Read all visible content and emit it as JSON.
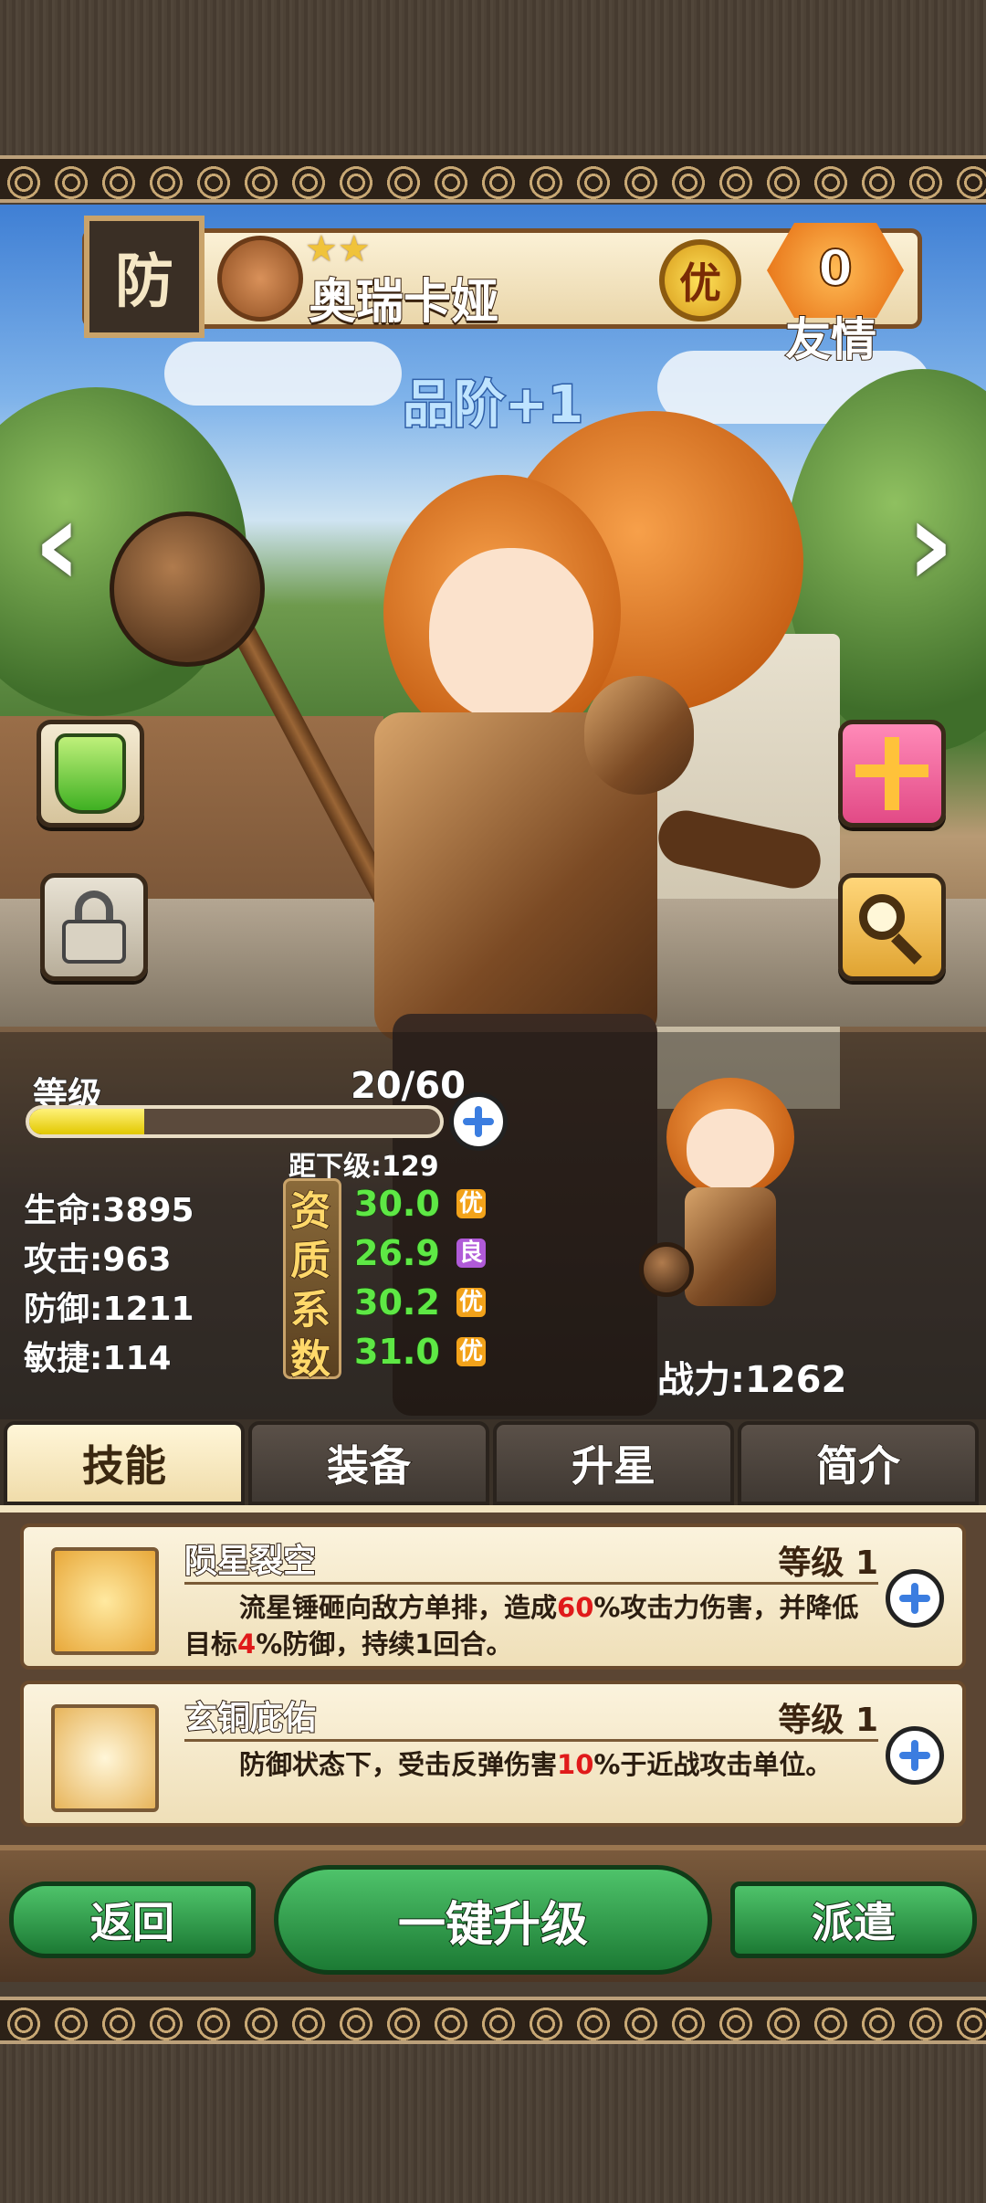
{
  "hero": {
    "class_badge": "防",
    "stars": "★★",
    "name": "奥瑞卡娅",
    "rarity": "优",
    "friendship_value": "0",
    "friendship_label": "友情",
    "quality": "品阶+1"
  },
  "nav": {
    "prev": "‹",
    "next": "›"
  },
  "level": {
    "label": "等级",
    "value": "20/60",
    "progress_fraction": 0.28,
    "to_next": "距下级:129"
  },
  "stats": [
    {
      "text": "生命:3895"
    },
    {
      "text": "攻击:963"
    },
    {
      "text": "防御:1211"
    },
    {
      "text": "敏捷:114"
    }
  ],
  "aptitude": [
    {
      "char": "资",
      "value": "30.0",
      "rank": "优",
      "rank_color": "#f2a21a"
    },
    {
      "char": "质",
      "value": "26.9",
      "rank": "良",
      "rank_color": "#b05ad8"
    },
    {
      "char": "系",
      "value": "30.2",
      "rank": "优",
      "rank_color": "#f2a21a"
    },
    {
      "char": "数",
      "value": "31.0",
      "rank": "优",
      "rank_color": "#f2a21a"
    }
  ],
  "power": "战力:1262",
  "tabs": [
    {
      "label": "技能",
      "active": true
    },
    {
      "label": "装备"
    },
    {
      "label": "升星"
    },
    {
      "label": "简介"
    }
  ],
  "skills": [
    {
      "name": "陨星裂空",
      "level": "等级 1",
      "desc_parts": [
        "流星锤砸向敌方单排，造成",
        "60",
        "%攻击力伤害，并降低目标",
        "4",
        "%防御，持续1回合。"
      ]
    },
    {
      "name": "玄铜庇佑",
      "level": "等级 1",
      "desc_parts": [
        "防御状态下，受击反弹伤害",
        "10",
        "%于近战攻击单位。"
      ]
    }
  ],
  "actions": {
    "back": "返回",
    "upgrade_all": "一键升级",
    "dispatch": "派遣"
  },
  "side_icons": [
    "potion-icon",
    "lock-icon",
    "gift-icon",
    "magnifier-icon"
  ]
}
